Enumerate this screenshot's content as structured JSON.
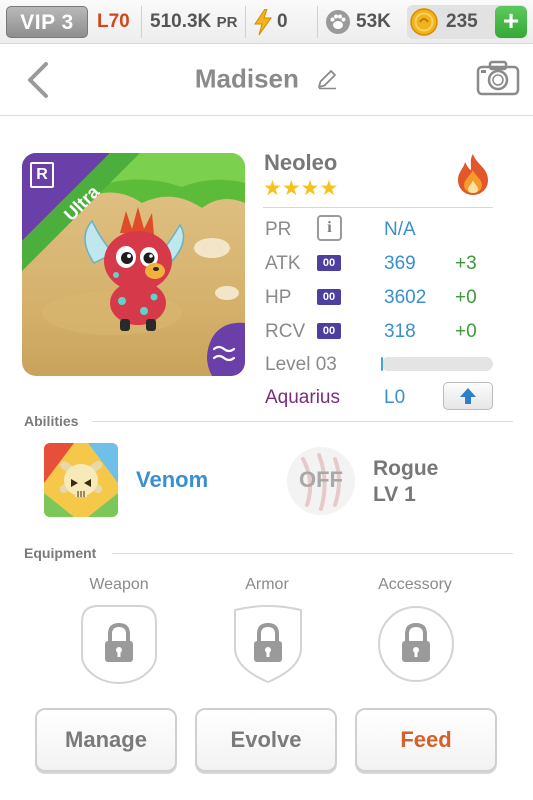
{
  "status_bar": {
    "vip": "VIP 3",
    "level": "L70",
    "power": "510.3K",
    "power_suffix": "PR",
    "energy": "0",
    "food": "53K",
    "gold": "235",
    "add_label": "+"
  },
  "header": {
    "title": "Madisen"
  },
  "card": {
    "rarity_letter": "R",
    "rarity": "Ultra"
  },
  "monster": {
    "name": "Neoleo",
    "stars": "★★★★",
    "star_count": 4,
    "element": "fire"
  },
  "stats": {
    "pr": {
      "label": "PR",
      "info": "i",
      "value": "N/A"
    },
    "atk": {
      "label": "ATK",
      "badge": "00",
      "value": "369",
      "bonus": "+3"
    },
    "hp": {
      "label": "HP",
      "badge": "00",
      "value": "3602",
      "bonus": "+0"
    },
    "rcv": {
      "label": "RCV",
      "badge": "00",
      "value": "318",
      "bonus": "+0"
    },
    "level": {
      "label": "Level 03",
      "progress": 0.02
    },
    "zodiac": {
      "label": "Aquarius",
      "value": "L0"
    }
  },
  "abilities": {
    "title": "Abilities",
    "primary": "Venom",
    "secondary_state": "OFF",
    "secondary_name": "Rogue",
    "secondary_level": "LV 1"
  },
  "equipment": {
    "title": "Equipment",
    "slots": [
      "Weapon",
      "Armor",
      "Accessory"
    ]
  },
  "buttons": {
    "manage": "Manage",
    "evolve": "Evolve",
    "feed": "Feed"
  },
  "colors": {
    "accent_blue": "#3a8fd0",
    "bonus_green": "#3c9a3c",
    "zodiac_purple": "#7a2d7a",
    "feed_orange": "#d2622a",
    "ultra_green": "#4cae3c",
    "rarity_purple": "#6b3fa8"
  }
}
